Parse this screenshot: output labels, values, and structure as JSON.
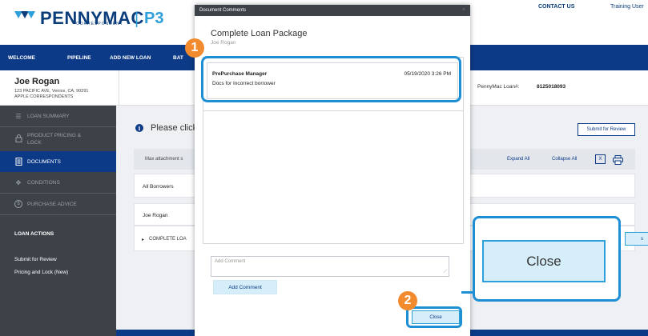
{
  "header": {
    "logo_text": "PENNYMAC",
    "logo_sub": "CORRESPONDENT",
    "logo_sep": "|",
    "logo_p3": "P3",
    "contact": "CONTACT US",
    "training": "Training User"
  },
  "nav": {
    "items": [
      "WELCOME",
      "PIPELINE",
      "ADD NEW LOAN",
      "BAT"
    ]
  },
  "borrower": {
    "name": "Joe Rogan",
    "address": "123 PACIFIC AVE, Venice, CA, 90291",
    "company": "APPLE CORRESPONDENTS",
    "loan_label": "PennyMac Loan#:",
    "loan_number": "8125018093"
  },
  "sidebar": {
    "items": [
      {
        "label": "LOAN SUMMARY",
        "icon": "list-icon"
      },
      {
        "label": "PRODUCT PRICING &",
        "label2": "LOCK",
        "icon": "lock-icon"
      },
      {
        "label": "DOCUMENTS",
        "icon": "document-icon"
      },
      {
        "label": "CONDITIONS",
        "icon": "conditions-icon"
      },
      {
        "label": "PURCHASE ADVICE",
        "icon": "dollar-icon"
      }
    ],
    "actions_heading": "LOAN ACTIONS",
    "actions": [
      "Submit for Review",
      "Pricing and Lock (New)"
    ]
  },
  "main": {
    "notice": "Please click",
    "submit_button": "Submit for Review",
    "max_attachment": "Max attachment s",
    "expand_all": "Expand All",
    "collapse_all": "Collapse All",
    "excel_icon_glyph": "X",
    "all_borrowers": "All Borrowers",
    "borrower_row": "Joe Rogan",
    "complete_row": "COMPLETE LOA",
    "row_button_tail": "s"
  },
  "modal": {
    "title": "Document Comments",
    "close_x": "×",
    "heading": "Complete Loan Package",
    "subheading": "Joe Rogan",
    "comments": [
      {
        "author": "PrePurchase Manager",
        "date": "05/19/2020 3:26 PM",
        "text": "Docs for Incorrect borrower"
      }
    ],
    "input_placeholder": "Add Comment",
    "add_button": "Add Comment",
    "close_button": "Close"
  },
  "callouts": {
    "badge1": "1",
    "badge2": "2",
    "zoom_label": "Close"
  },
  "colors": {
    "nav_blue": "#0d3a87",
    "accent_blue": "#2d9fd9",
    "highlight": "#1f8fd3",
    "badge_orange": "#f28a2e",
    "sidebar_dark": "#3d4148"
  }
}
